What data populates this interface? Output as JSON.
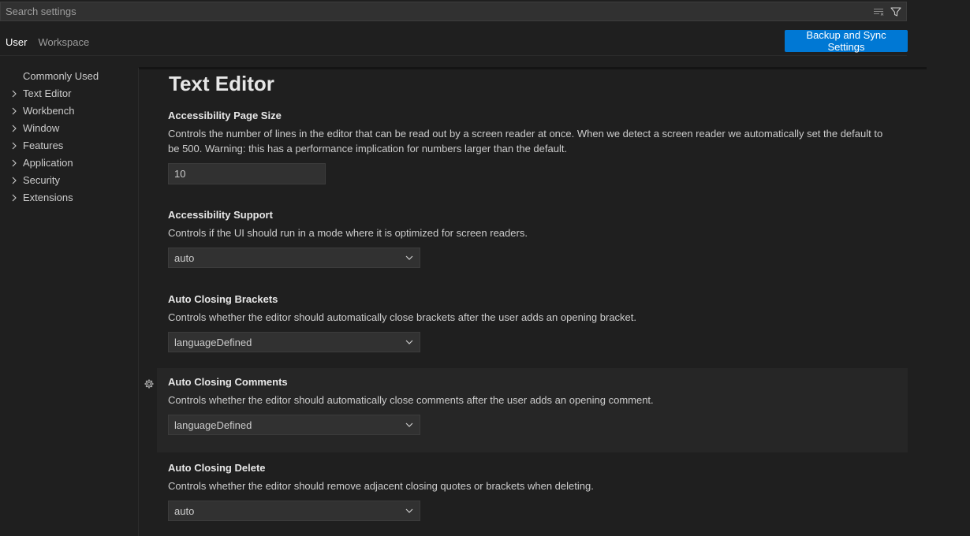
{
  "search": {
    "placeholder": "Search settings",
    "clear_filter_icon": "clear-filter-icon",
    "filter_icon": "filter-icon"
  },
  "tabs": [
    {
      "label": "User",
      "active": true
    },
    {
      "label": "Workspace",
      "active": false
    }
  ],
  "sync_button": {
    "label": "Backup and Sync Settings",
    "color": "#0078d4"
  },
  "toc": [
    {
      "label": "Commonly Used",
      "expandable": false
    },
    {
      "label": "Text Editor",
      "expandable": true
    },
    {
      "label": "Workbench",
      "expandable": true
    },
    {
      "label": "Window",
      "expandable": true
    },
    {
      "label": "Features",
      "expandable": true
    },
    {
      "label": "Application",
      "expandable": true
    },
    {
      "label": "Security",
      "expandable": true
    },
    {
      "label": "Extensions",
      "expandable": true
    }
  ],
  "section": {
    "title": "Text Editor"
  },
  "settings": [
    {
      "title": "Accessibility Page Size",
      "description": "Controls the number of lines in the editor that can be read out by a screen reader at once. When we detect a screen reader we automatically set the default to be 500. Warning: this has a performance implication for numbers larger than the default.",
      "control": "number",
      "value": "10"
    },
    {
      "title": "Accessibility Support",
      "description": "Controls if the UI should run in a mode where it is optimized for screen readers.",
      "control": "select",
      "value": "auto"
    },
    {
      "title": "Auto Closing Brackets",
      "description": "Controls whether the editor should automatically close brackets after the user adds an opening bracket.",
      "control": "select",
      "value": "languageDefined"
    },
    {
      "title": "Auto Closing Comments",
      "description": "Controls whether the editor should automatically close comments after the user adds an opening comment.",
      "control": "select",
      "value": "languageDefined"
    },
    {
      "title": "Auto Closing Delete",
      "description": "Controls whether the editor should remove adjacent closing quotes or brackets when deleting.",
      "control": "select",
      "value": "auto"
    }
  ],
  "gear_icon": "gear-icon"
}
